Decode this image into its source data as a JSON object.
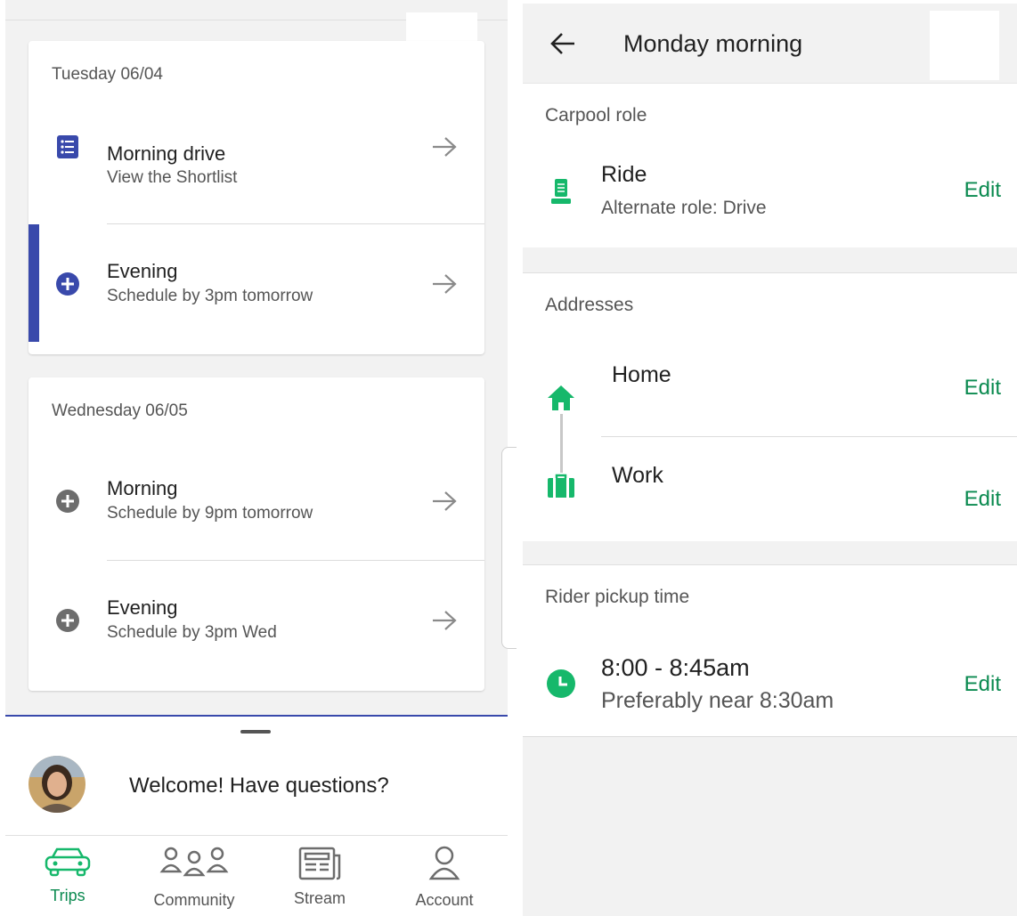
{
  "left": {
    "days": [
      {
        "date": "Tuesday 06/04",
        "rows": [
          {
            "title": "Morning drive",
            "subtitle": "View the Shortlist"
          },
          {
            "title": "Evening",
            "subtitle": "Schedule by 3pm tomorrow"
          }
        ]
      },
      {
        "date": "Wednesday 06/05",
        "rows": [
          {
            "title": "Morning",
            "subtitle": "Schedule by 9pm tomorrow"
          },
          {
            "title": "Evening",
            "subtitle": "Schedule by 3pm Wed"
          }
        ]
      }
    ],
    "welcome": "Welcome! Have questions?",
    "nav": [
      {
        "label": "Trips",
        "icon": "car-icon",
        "active": true
      },
      {
        "label": "Community",
        "icon": "people-icon",
        "active": false
      },
      {
        "label": "Stream",
        "icon": "newspaper-icon",
        "active": false
      },
      {
        "label": "Account",
        "icon": "person-icon",
        "active": false
      }
    ]
  },
  "right": {
    "title": "Monday morning",
    "carpool_role": {
      "header": "Carpool role",
      "role": "Ride",
      "alternate": "Alternate role: Drive",
      "edit": "Edit"
    },
    "addresses": {
      "header": "Addresses",
      "home": "Home",
      "work": "Work",
      "edit_home": "Edit",
      "edit_work": "Edit"
    },
    "pickup": {
      "header": "Rider pickup time",
      "time": "8:00 - 8:45am",
      "preference": "Preferably near 8:30am",
      "edit": "Edit"
    }
  },
  "colors": {
    "accent_blue": "#3949ab",
    "brand_green": "#0b8a50",
    "icon_green": "#16b86b",
    "icon_gray": "#6d6d6d"
  }
}
